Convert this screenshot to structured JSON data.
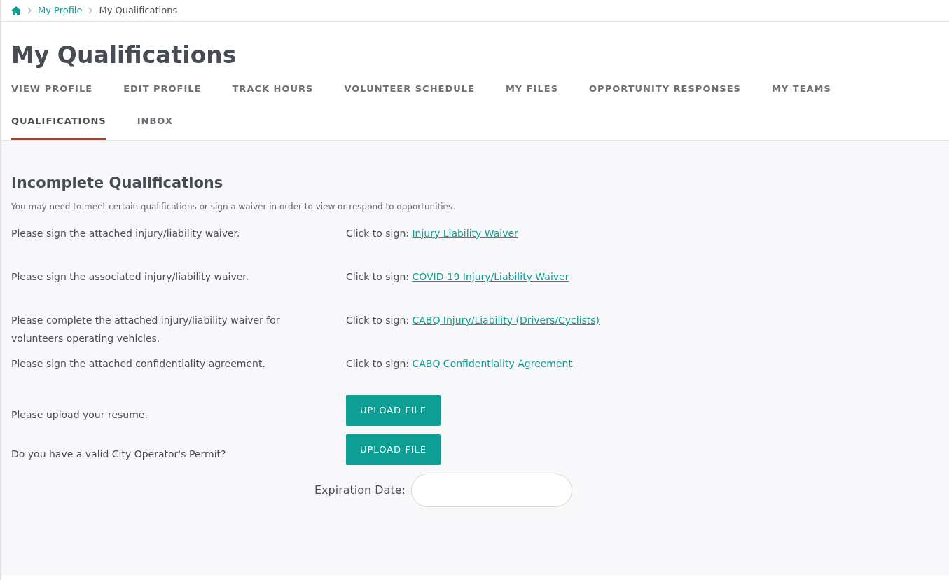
{
  "breadcrumb": {
    "items": [
      {
        "label": "My Profile",
        "kind": "link"
      },
      {
        "label": "My Qualifications",
        "kind": "current"
      }
    ]
  },
  "page_title": "My Qualifications",
  "tabs": [
    {
      "label": "VIEW PROFILE",
      "selected": false
    },
    {
      "label": "EDIT PROFILE",
      "selected": false
    },
    {
      "label": "TRACK HOURS",
      "selected": false
    },
    {
      "label": "VOLUNTEER SCHEDULE",
      "selected": false
    },
    {
      "label": "MY FILES",
      "selected": false
    },
    {
      "label": "OPPORTUNITY RESPONSES",
      "selected": false
    },
    {
      "label": "MY TEAMS",
      "selected": false
    },
    {
      "label": "QUALIFICATIONS",
      "selected": true
    },
    {
      "label": "INBOX",
      "selected": false
    }
  ],
  "section": {
    "title": "Incomplete Qualifications",
    "subtitle": "You may need to meet certain qualifications or sign a waiver in order to view or respond to opportunities.",
    "rows": [
      {
        "kind": "sign",
        "text": "Please sign the attached injury/liability waiver.",
        "prompt": "Click to sign:",
        "link": "Injury Liability Waiver"
      },
      {
        "kind": "sign",
        "text": "Please sign the associated injury/liability waiver.",
        "prompt": "Click to sign:",
        "link": "COVID-19 Injury/Liability Waiver"
      },
      {
        "kind": "sign",
        "text": "Please complete the attached injury/liability waiver for volunteers operating vehicles.",
        "prompt": "Click to sign:",
        "link": "CABQ Injury/Liability (Drivers/Cyclists)"
      },
      {
        "kind": "sign",
        "text": "Please sign the attached confidentiality agreement.",
        "prompt": "Click to sign:",
        "link": "CABQ Confidentiality Agreement"
      },
      {
        "kind": "upload",
        "text": "Please upload your resume.",
        "button": "UPLOAD FILE"
      },
      {
        "kind": "upload",
        "text": "Do you have a valid City Operator's Permit?",
        "button": "UPLOAD FILE"
      }
    ],
    "date_field": {
      "label": "Expiration Date:"
    }
  }
}
